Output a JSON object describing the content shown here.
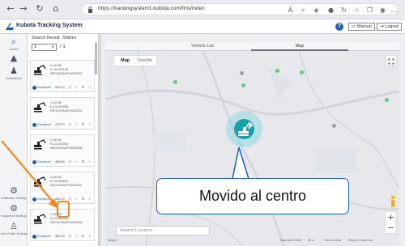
{
  "browser": {
    "url": "https://trackingsystem1.kubota.com/fms/index",
    "nav_icons": [
      "back-icon",
      "forward-icon",
      "reload-icon",
      "home-icon"
    ]
  },
  "app": {
    "title": "Kubota Tracking System",
    "manual_label": "Manual",
    "logout_label": "Logout",
    "help_label": "?"
  },
  "rail": {
    "items": [
      {
        "icon": "search-icon",
        "label": "Search"
      },
      {
        "icon": "alert-icon",
        "label": ""
      },
      {
        "icon": "notification-icon",
        "label": "Notifications"
      }
    ],
    "bottom_items": [
      {
        "icon": "gear-icon",
        "label": "Notification Settings"
      },
      {
        "icon": "settings-icon",
        "label": "Equipment Settings"
      },
      {
        "icon": "user-icon",
        "label": "User Profile Settings"
      }
    ]
  },
  "list": {
    "search_result_label": "Search Result : 5items",
    "page_value": "1",
    "page_total": "/ 1",
    "items": [
      {
        "model": "U-40-6E",
        "line2": "K-16-002193",
        "line3": "KBCDZ4AAP0J022093",
        "status": "Departure",
        "hours": "525.1h"
      },
      {
        "model": "U-40-6E",
        "line2": "K-13-040558",
        "line3": "KBCDZ4AAP0J022013",
        "status": "Departure",
        "hours": "470.7h"
      },
      {
        "model": "U-40-6E",
        "line2": "K-13-040508",
        "line3": "KBCDZ4AAP0J022008",
        "status": "Departure",
        "hours": "365.8h"
      },
      {
        "model": "U-40-6E",
        "line2": "K-13-040551",
        "line3": "KBCDZ4AAP0J022011",
        "status": "Departure",
        "hours": "444.7h"
      },
      {
        "model": "U-40-6E",
        "line2": "K-13-040519",
        "line3": "KBCDZ4AAP0J022015",
        "status": "Departure",
        "hours": "387.6h"
      }
    ]
  },
  "map": {
    "tabs": [
      "Vehicle List",
      "Map"
    ],
    "active_tab": "Map",
    "map_type_options": [
      "Map",
      "Satellite"
    ],
    "location_placeholder": "Search Location",
    "zoom_in": "+",
    "zoom_out": "−",
    "attribution": [
      "Map data ©2024",
      "50 m",
      "Terms of Use",
      "Report a map error"
    ],
    "brand": "Google",
    "marker_color": "#13a3a8"
  },
  "callout": {
    "text": "Movido al centro"
  },
  "colors": {
    "accent": "#1d5fb8",
    "highlight": "#f08a1d"
  }
}
